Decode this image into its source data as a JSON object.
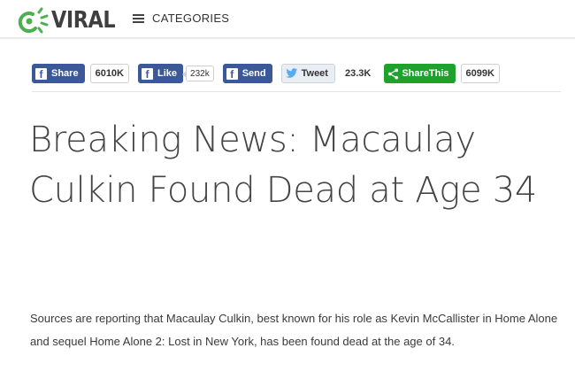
{
  "header": {
    "logo_text": "VIRAL",
    "categories_label": "CATEGORIES"
  },
  "share": {
    "fb_share_label": "Share",
    "fb_share_count": "6010K",
    "fb_like_label": "Like",
    "fb_like_count": "232k",
    "fb_send_label": "Send",
    "tweet_label": "Tweet",
    "tweet_count": "23.3K",
    "sharethis_label": "ShareThis",
    "sharethis_count": "6099K",
    "colors": {
      "facebook": "#3b5998",
      "sharethis": "#1fa12e",
      "logo_green": "#4caf50"
    }
  },
  "article": {
    "headline": "Breaking News: Macaulay Culkin Found Dead at Age 34",
    "body": "Sources are reporting that Macaulay Culkin, best known for his role as Kevin McCallister in Home Alone and sequel Home Alone 2: Lost in New York, has been found dead at the age of 34."
  }
}
